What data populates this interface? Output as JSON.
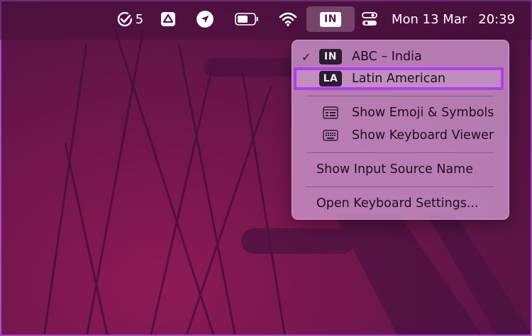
{
  "menubar": {
    "tasks_count": "5",
    "input_source_badge": "IN",
    "clock_date": "Mon 13 Mar",
    "clock_time": "20:39"
  },
  "menu": {
    "items": [
      {
        "badge": "IN",
        "label": "ABC – India",
        "checked": true
      },
      {
        "badge": "LA",
        "label": "Latin American",
        "highlighted": true
      },
      {
        "label": "Show Emoji & Symbols",
        "icon": "emoji-symbols-icon"
      },
      {
        "label": "Show Keyboard Viewer",
        "icon": "keyboard-icon"
      },
      {
        "label": "Show Input Source Name"
      },
      {
        "label": "Open Keyboard Settings..."
      }
    ]
  },
  "colors": {
    "wallpaper": "#74164d",
    "highlight_border": "#b43cf0",
    "frame_border": "#a24fc6"
  }
}
